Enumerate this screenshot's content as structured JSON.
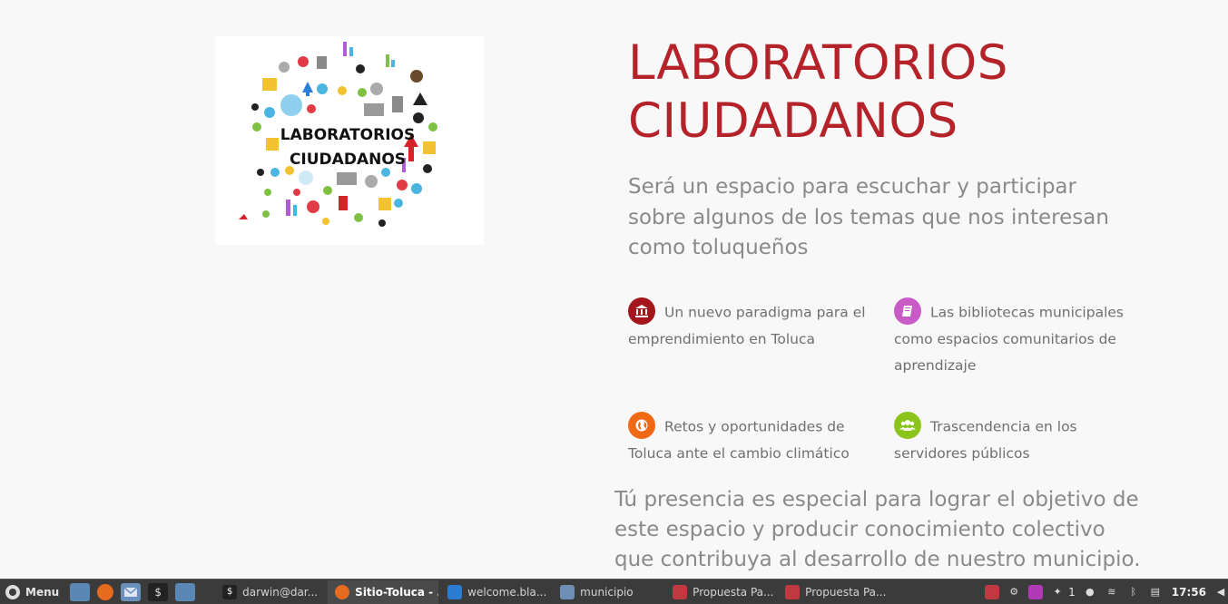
{
  "logo": {
    "line1": "LABORATORIOS",
    "line2": "CIUDADANOS"
  },
  "hero": {
    "title_line1": "LABORATORIOS",
    "title_line2": "CIUDADANOS",
    "lead": "Será un espacio para escuchar y participar sobre algunos de los temas que nos interesan como toluqueños"
  },
  "features": [
    {
      "icon": "bank-icon",
      "color": "#a3161c",
      "text": "Un nuevo paradigma para el emprendimiento en Toluca"
    },
    {
      "icon": "book-icon",
      "color": "#c95bc7",
      "text": "Las bibliotecas municipales como espacios comunitarios de aprendizaje"
    },
    {
      "icon": "globe-icon",
      "color": "#f06a16",
      "text": "Retos y oportunidades de Toluca ante el cambio climático"
    },
    {
      "icon": "users-icon",
      "color": "#8bc41a",
      "text": "Trascendencia en los servidores públicos"
    }
  ],
  "outro": "Tú presencia es especial para lograr el objetivo de este espacio y producir conocimiento colectivo que contribuya al desarrollo de nuestro municipio.",
  "taskbar": {
    "menu_label": "Menu",
    "tasks": [
      {
        "label": "darwin@dar...",
        "icon": "terminal-icon"
      },
      {
        "label": "Sitio-Toluca - ...",
        "icon": "firefox-icon"
      },
      {
        "label": "welcome.bla...",
        "icon": "vscode-icon"
      },
      {
        "label": "municipio",
        "icon": "folder-icon"
      },
      {
        "label": "Propuesta Pa...",
        "icon": "document-viewer-icon"
      },
      {
        "label": "Propuesta Pa...",
        "icon": "document-viewer-icon"
      }
    ],
    "notification_count": "1",
    "clock": "17:56"
  }
}
